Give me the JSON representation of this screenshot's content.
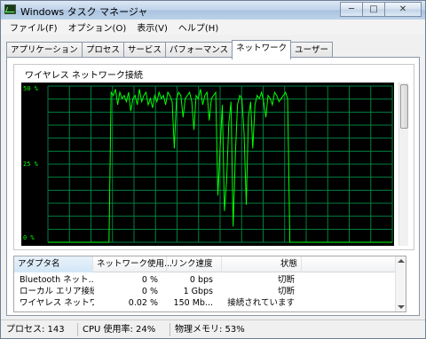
{
  "window": {
    "title": "Windows タスク マネージャ"
  },
  "titlebar": {
    "minimize_glyph": "─",
    "maximize_glyph": "□",
    "close_glyph": "✕"
  },
  "menu": [
    {
      "label": "ファイル(F)"
    },
    {
      "label": "オプション(O)"
    },
    {
      "label": "表示(V)"
    },
    {
      "label": "ヘルプ(H)"
    }
  ],
  "tabs": [
    {
      "label": "アプリケーション"
    },
    {
      "label": "プロセス"
    },
    {
      "label": "サービス"
    },
    {
      "label": "パフォーマンス"
    },
    {
      "label": "ネットワーク",
      "active": true
    },
    {
      "label": "ユーザー"
    }
  ],
  "graph": {
    "title": "ワイヤレス ネットワーク接続",
    "y_labels": [
      "50 %",
      "25 %",
      "0 %"
    ],
    "line_color": "#00ff00",
    "grid_color": "#008040"
  },
  "chart_data": {
    "type": "line",
    "title": "ワイヤレス ネットワーク接続",
    "ylim": [
      0,
      50
    ],
    "y_ticks": [
      "50 %",
      "25 %",
      "0 %"
    ],
    "grid": true,
    "series": [
      {
        "values": [
          0,
          0,
          0,
          0,
          0,
          0,
          0,
          0,
          0,
          0,
          0,
          0,
          0,
          0,
          0,
          0,
          0,
          0,
          0,
          0,
          0,
          0,
          0,
          0,
          0,
          0,
          0,
          0,
          0,
          48,
          47,
          49,
          44,
          48,
          46,
          47,
          45,
          48,
          42,
          46,
          47,
          44,
          49,
          45,
          47,
          48,
          44,
          46,
          43,
          47,
          45,
          48,
          46,
          47,
          44,
          48,
          47,
          45,
          30,
          46,
          48,
          47,
          40,
          46,
          47,
          48,
          45,
          36,
          47,
          46,
          49,
          44,
          47,
          48,
          39,
          46,
          47,
          48,
          15,
          30,
          44,
          10,
          20,
          38,
          45,
          5,
          28,
          44,
          47,
          46,
          35,
          12,
          40,
          45,
          30,
          44,
          47,
          46,
          48,
          45,
          40,
          47,
          46,
          44,
          48,
          47,
          45,
          46,
          47,
          48,
          46,
          0,
          0,
          0,
          0,
          0,
          0,
          0,
          0,
          0,
          0,
          0,
          0,
          0,
          0,
          0,
          0,
          0,
          0,
          0,
          0,
          0,
          0,
          0,
          0,
          0,
          0,
          0,
          0,
          0,
          0,
          0,
          0,
          0,
          0,
          0,
          0,
          0,
          0,
          0,
          0,
          0,
          0,
          0,
          0,
          0,
          0,
          0,
          0
        ]
      }
    ]
  },
  "adapter_table": {
    "columns": [
      "アダプタ名",
      "ネットワーク使用...",
      "リンク速度",
      "状態"
    ],
    "rows": [
      [
        "Bluetooth ネット...",
        "0 %",
        "0 bps",
        "切断"
      ],
      [
        "ローカル エリア接続",
        "0 %",
        "1 Gbps",
        "切断"
      ],
      [
        "ワイヤレス ネットワ...",
        "0.02 %",
        "150 Mb...",
        "接続されています"
      ]
    ]
  },
  "status": {
    "processes": "プロセス: 143",
    "cpu": "CPU 使用率: 24%",
    "memory": "物理メモリ: 53%"
  }
}
